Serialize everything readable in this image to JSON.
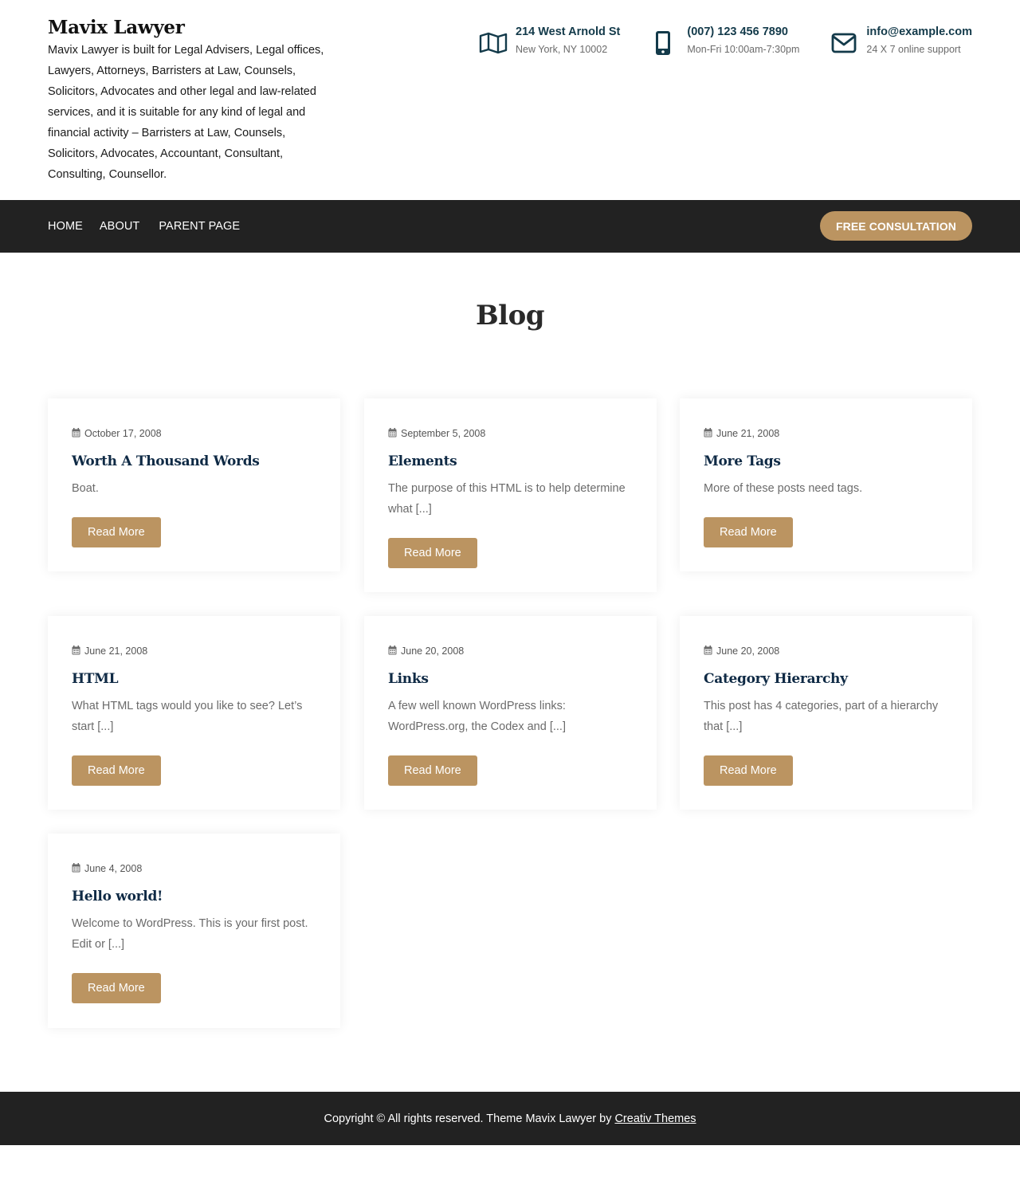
{
  "site": {
    "title": "Mavix Lawyer",
    "description": "Mavix Lawyer is built for Legal Advisers, Legal offices, Lawyers, Attorneys, Barristers at Law, Counsels, Solicitors, Advocates and other legal and law-related services, and it is suitable for any kind of legal and financial activity – Barristers at Law, Counsels, Solicitors, Advocates, Accountant, Consultant, Consulting, Counsellor."
  },
  "contacts": {
    "address": {
      "title": "214 West Arnold St",
      "sub": "New York, NY 10002",
      "icon": "map-icon"
    },
    "phone": {
      "title": "(007) 123 456 7890",
      "sub": "Mon-Fri 10:00am-7:30pm",
      "icon": "mobile-phone-icon"
    },
    "email": {
      "title": "info@example.com",
      "sub": "24 X 7 online support",
      "icon": "envelope-icon"
    }
  },
  "nav": {
    "items": [
      "HOME",
      "ABOUT",
      "PARENT PAGE"
    ],
    "cta": "FREE CONSULTATION"
  },
  "page": {
    "title": "Blog"
  },
  "posts": [
    {
      "date": "October 17, 2008",
      "title": "Worth A Thousand Words",
      "excerpt": "Boat.",
      "button": "Read More"
    },
    {
      "date": "September 5, 2008",
      "title": "Elements",
      "excerpt": "The purpose of this HTML is to help determine what [...]",
      "button": "Read More"
    },
    {
      "date": "June 21, 2008",
      "title": "More Tags",
      "excerpt": "More of these posts need tags.",
      "button": "Read More"
    },
    {
      "date": "June 21, 2008",
      "title": "HTML",
      "excerpt": "What HTML tags would you like to see? Let’s start [...]",
      "button": "Read More"
    },
    {
      "date": "June 20, 2008",
      "title": "Links",
      "excerpt": "A few well known WordPress links: WordPress.org, the Codex and [...]",
      "button": "Read More"
    },
    {
      "date": "June 20, 2008",
      "title": "Category Hierarchy",
      "excerpt": "This post has 4 categories, part of a hierarchy that [...]",
      "button": "Read More"
    },
    {
      "date": "June 4, 2008",
      "title": "Hello world!",
      "excerpt": "Welcome to WordPress. This is your first post. Edit or [...]",
      "button": "Read More"
    }
  ],
  "footer": {
    "text": "Copyright © All rights reserved. Theme Mavix Lawyer by",
    "link": "Creativ Themes"
  },
  "colors": {
    "accent": "#bb9461",
    "dark": "#222222",
    "heading": "#0f2a45",
    "contact": "#133a4a"
  }
}
